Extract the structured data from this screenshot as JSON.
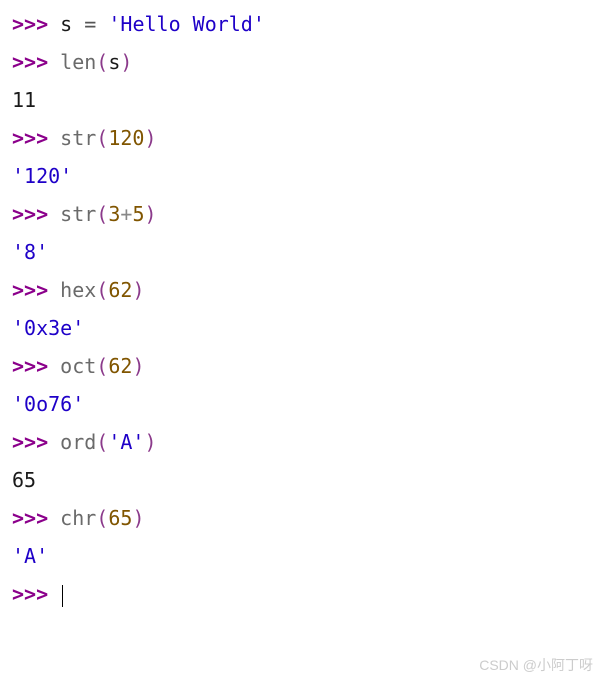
{
  "lines": [
    {
      "type": "input",
      "segments": [
        {
          "cls": "prompt",
          "text": ">>> "
        },
        {
          "cls": "identifier",
          "text": "s "
        },
        {
          "cls": "operator",
          "text": "= "
        },
        {
          "cls": "string",
          "text": "'Hello World'"
        }
      ]
    },
    {
      "type": "input",
      "segments": [
        {
          "cls": "prompt",
          "text": ">>> "
        },
        {
          "cls": "func",
          "text": "len"
        },
        {
          "cls": "paren",
          "text": "("
        },
        {
          "cls": "identifier",
          "text": "s"
        },
        {
          "cls": "paren",
          "text": ")"
        }
      ]
    },
    {
      "type": "output",
      "segments": [
        {
          "cls": "output",
          "text": "11"
        }
      ]
    },
    {
      "type": "input",
      "segments": [
        {
          "cls": "prompt",
          "text": ">>> "
        },
        {
          "cls": "func",
          "text": "str"
        },
        {
          "cls": "paren",
          "text": "("
        },
        {
          "cls": "number",
          "text": "120"
        },
        {
          "cls": "paren",
          "text": ")"
        }
      ]
    },
    {
      "type": "output",
      "segments": [
        {
          "cls": "output-string",
          "text": "'120'"
        }
      ]
    },
    {
      "type": "input",
      "segments": [
        {
          "cls": "prompt",
          "text": ">>> "
        },
        {
          "cls": "func",
          "text": "str"
        },
        {
          "cls": "paren",
          "text": "("
        },
        {
          "cls": "number",
          "text": "3"
        },
        {
          "cls": "plus",
          "text": "+"
        },
        {
          "cls": "number",
          "text": "5"
        },
        {
          "cls": "paren",
          "text": ")"
        }
      ]
    },
    {
      "type": "output",
      "segments": [
        {
          "cls": "output-string",
          "text": "'8'"
        }
      ]
    },
    {
      "type": "input",
      "segments": [
        {
          "cls": "prompt",
          "text": ">>> "
        },
        {
          "cls": "func",
          "text": "hex"
        },
        {
          "cls": "paren",
          "text": "("
        },
        {
          "cls": "number",
          "text": "62"
        },
        {
          "cls": "paren",
          "text": ")"
        }
      ]
    },
    {
      "type": "output",
      "segments": [
        {
          "cls": "output-string",
          "text": "'0x3e'"
        }
      ]
    },
    {
      "type": "input",
      "segments": [
        {
          "cls": "prompt",
          "text": ">>> "
        },
        {
          "cls": "func",
          "text": "oct"
        },
        {
          "cls": "paren",
          "text": "("
        },
        {
          "cls": "number",
          "text": "62"
        },
        {
          "cls": "paren",
          "text": ")"
        }
      ]
    },
    {
      "type": "output",
      "segments": [
        {
          "cls": "output-string",
          "text": "'0o76'"
        }
      ]
    },
    {
      "type": "input",
      "segments": [
        {
          "cls": "prompt",
          "text": ">>> "
        },
        {
          "cls": "func",
          "text": "ord"
        },
        {
          "cls": "paren",
          "text": "("
        },
        {
          "cls": "string",
          "text": "'A'"
        },
        {
          "cls": "paren",
          "text": ")"
        }
      ]
    },
    {
      "type": "output",
      "segments": [
        {
          "cls": "output",
          "text": "65"
        }
      ]
    },
    {
      "type": "input",
      "segments": [
        {
          "cls": "prompt",
          "text": ">>> "
        },
        {
          "cls": "func",
          "text": "chr"
        },
        {
          "cls": "paren",
          "text": "("
        },
        {
          "cls": "number",
          "text": "65"
        },
        {
          "cls": "paren",
          "text": ")"
        }
      ]
    },
    {
      "type": "output",
      "segments": [
        {
          "cls": "output-string",
          "text": "'A'"
        }
      ]
    },
    {
      "type": "input",
      "segments": [
        {
          "cls": "prompt",
          "text": ">>> "
        }
      ],
      "cursor": true
    }
  ],
  "watermark": "CSDN @小阿丁呀"
}
